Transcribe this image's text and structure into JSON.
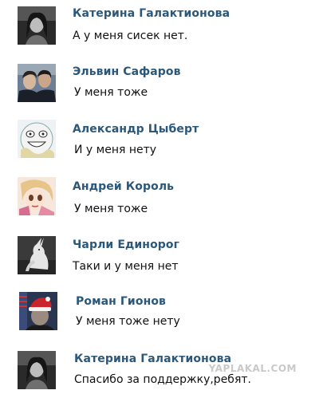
{
  "comments": [
    {
      "author": "Катерина Галактионова",
      "text": "А у меня сисек нет.",
      "avatar": "girl-bw-photo"
    },
    {
      "author": "Эльвин Сафаров",
      "text": "У меня тоже",
      "avatar": "two-guys-photo"
    },
    {
      "author": "Александр Цыберт",
      "text": "И у меня нету",
      "avatar": "meme-face"
    },
    {
      "author": "Андрей Король",
      "text": "У меня тоже",
      "avatar": "anime-character"
    },
    {
      "author": "Чарли Единорог",
      "text": "Таки и у меня нет",
      "avatar": "unicorn-photo"
    },
    {
      "author": "Роман Гионов",
      "text": "У меня тоже нету",
      "avatar": "santa-hat-photo"
    },
    {
      "author": "Катерина Галактионова",
      "text": "Спасибо за поддержку,ребят.",
      "avatar": "girl-bw-photo"
    }
  ],
  "watermark": "YAPLAKAL.COM",
  "colors": {
    "author_link": "#2b587a",
    "text": "#111111",
    "watermark": "#c9c9c9"
  }
}
